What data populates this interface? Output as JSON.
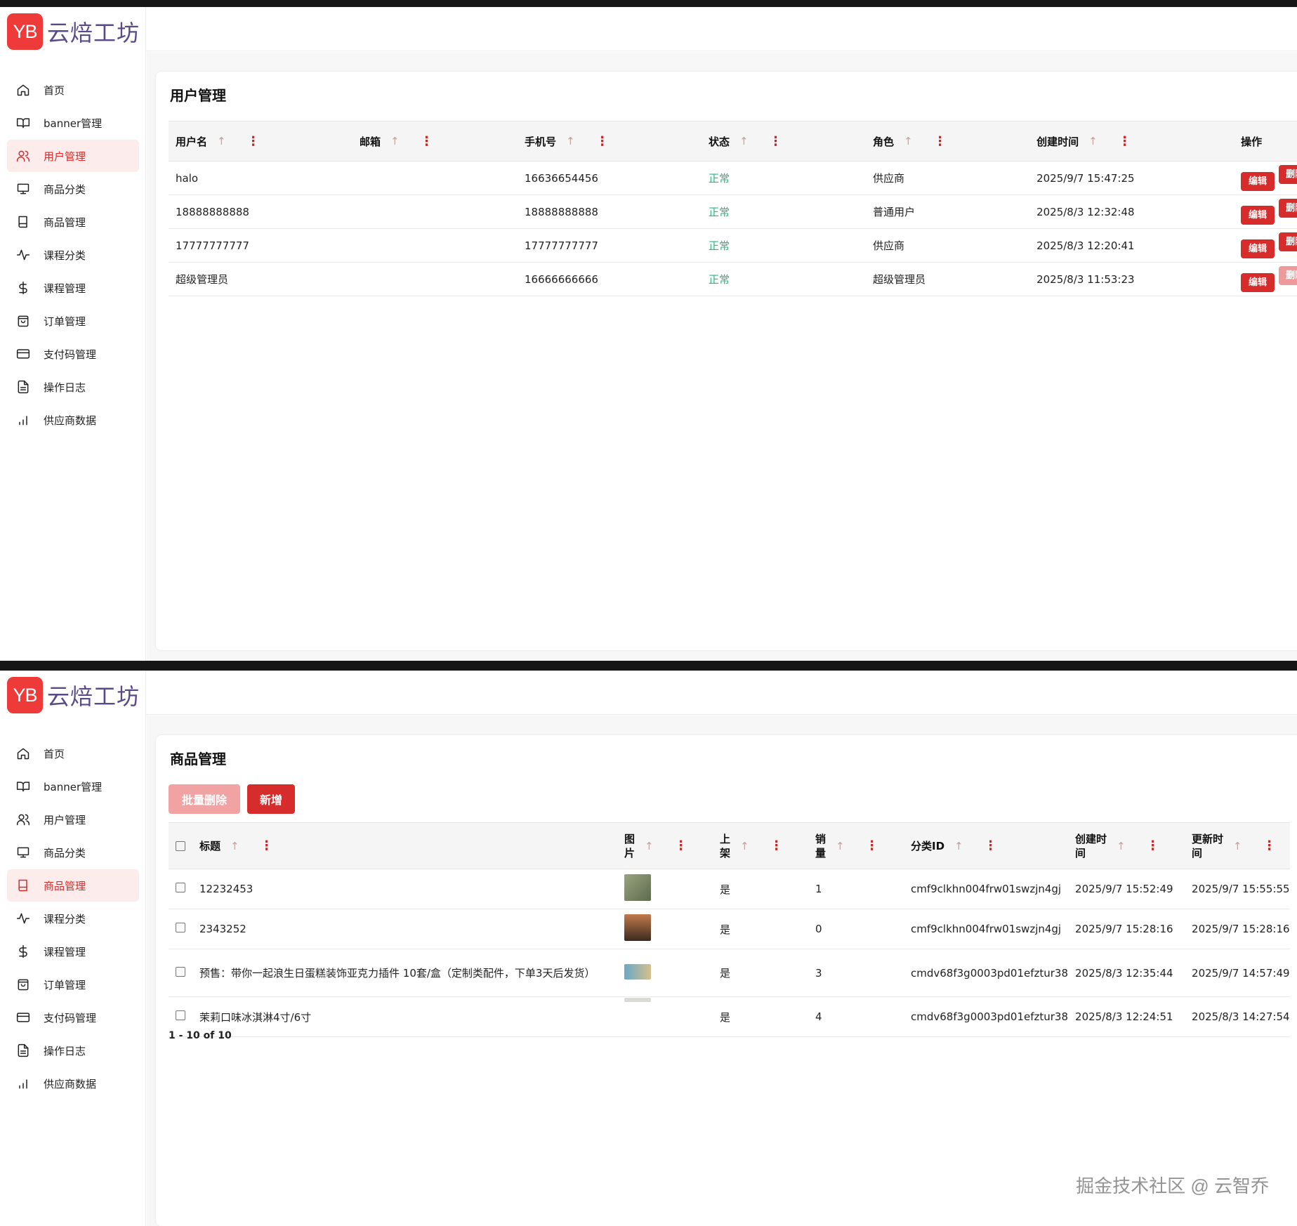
{
  "app": {
    "logo_badge": "YB",
    "logo_text": "云焙工坊"
  },
  "nav": {
    "home": "首页",
    "banner": "banner管理",
    "users": "用户管理",
    "product_category": "商品分类",
    "products": "商品管理",
    "course_category": "课程分类",
    "courses": "课程管理",
    "orders": "订单管理",
    "paycode": "支付码管理",
    "logs": "操作日志",
    "supplier_data": "供应商数据"
  },
  "users_page": {
    "title": "用户管理",
    "columns": {
      "username": "用户名",
      "email": "邮箱",
      "phone": "手机号",
      "status": "状态",
      "role": "角色",
      "created": "创建时间",
      "actions": "操作"
    },
    "sort_glyph": "↑",
    "kebab_glyph": "⋮",
    "edit_label": "编辑",
    "delete_label": "删除",
    "rows": [
      {
        "username": "halo",
        "email": "",
        "phone": "16636654456",
        "status": "正常",
        "role": "供应商",
        "created": "2025/9/7 15:47:25"
      },
      {
        "username": "18888888888",
        "email": "",
        "phone": "18888888888",
        "status": "正常",
        "role": "普通用户",
        "created": "2025/8/3 12:32:48"
      },
      {
        "username": "17777777777",
        "email": "",
        "phone": "17777777777",
        "status": "正常",
        "role": "供应商",
        "created": "2025/8/3 12:20:41"
      },
      {
        "username": "超级管理员",
        "email": "",
        "phone": "16666666666",
        "status": "正常",
        "role": "超级管理员",
        "created": "2025/8/3 11:53:23"
      }
    ]
  },
  "products_page": {
    "title": "商品管理",
    "batch_delete_label": "批量删除",
    "add_label": "新增",
    "columns": {
      "title": "标题",
      "image_l1": "图",
      "image_l2": "片",
      "listed_l1": "上",
      "listed_l2": "架",
      "sales_l1": "销",
      "sales_l2": "量",
      "category_id": "分类ID",
      "created_l1": "创建时",
      "created_l2": "间",
      "updated_l1": "更新时",
      "updated_l2": "间"
    },
    "rows": [
      {
        "title": "12232453",
        "listed": "是",
        "sales": "1",
        "category_id": "cmf9clkhn004frw01swzjn4gj",
        "created": "2025/9/7 15:52:49",
        "updated": "2025/9/7 15:55:55",
        "thumb_color": "#7d8a6a"
      },
      {
        "title": "2343252",
        "listed": "是",
        "sales": "0",
        "category_id": "cmf9clkhn004frw01swzjn4gj",
        "created": "2025/9/7 15:28:16",
        "updated": "2025/9/7 15:28:16",
        "thumb_color": "#5a4a3a"
      },
      {
        "title": "预售：带你一起浪生日蛋糕装饰亚克力插件 10套/盒（定制类配件，下单3天后发货）",
        "listed": "是",
        "sales": "3",
        "category_id": "cmdv68f3g0003pd01efztur38",
        "created": "2025/8/3 12:35:44",
        "updated": "2025/9/7 14:57:49",
        "thumb_color": "#6aa8c8"
      },
      {
        "title": "茉莉口味冰淇淋4寸/6寸",
        "listed": "是",
        "sales": "4",
        "category_id": "cmdv68f3g0003pd01efztur38",
        "created": "2025/8/3 12:24:51",
        "updated": "2025/8/3 14:27:54",
        "thumb_color": "#d8dcd4"
      }
    ],
    "pagination": "1 - 10 of 10"
  },
  "watermark": "掘金技术社区 @ 云智乔",
  "colors": {
    "accent": "#d62c2c",
    "active_bg": "#fdecec",
    "status_ok": "#2fb37a"
  }
}
